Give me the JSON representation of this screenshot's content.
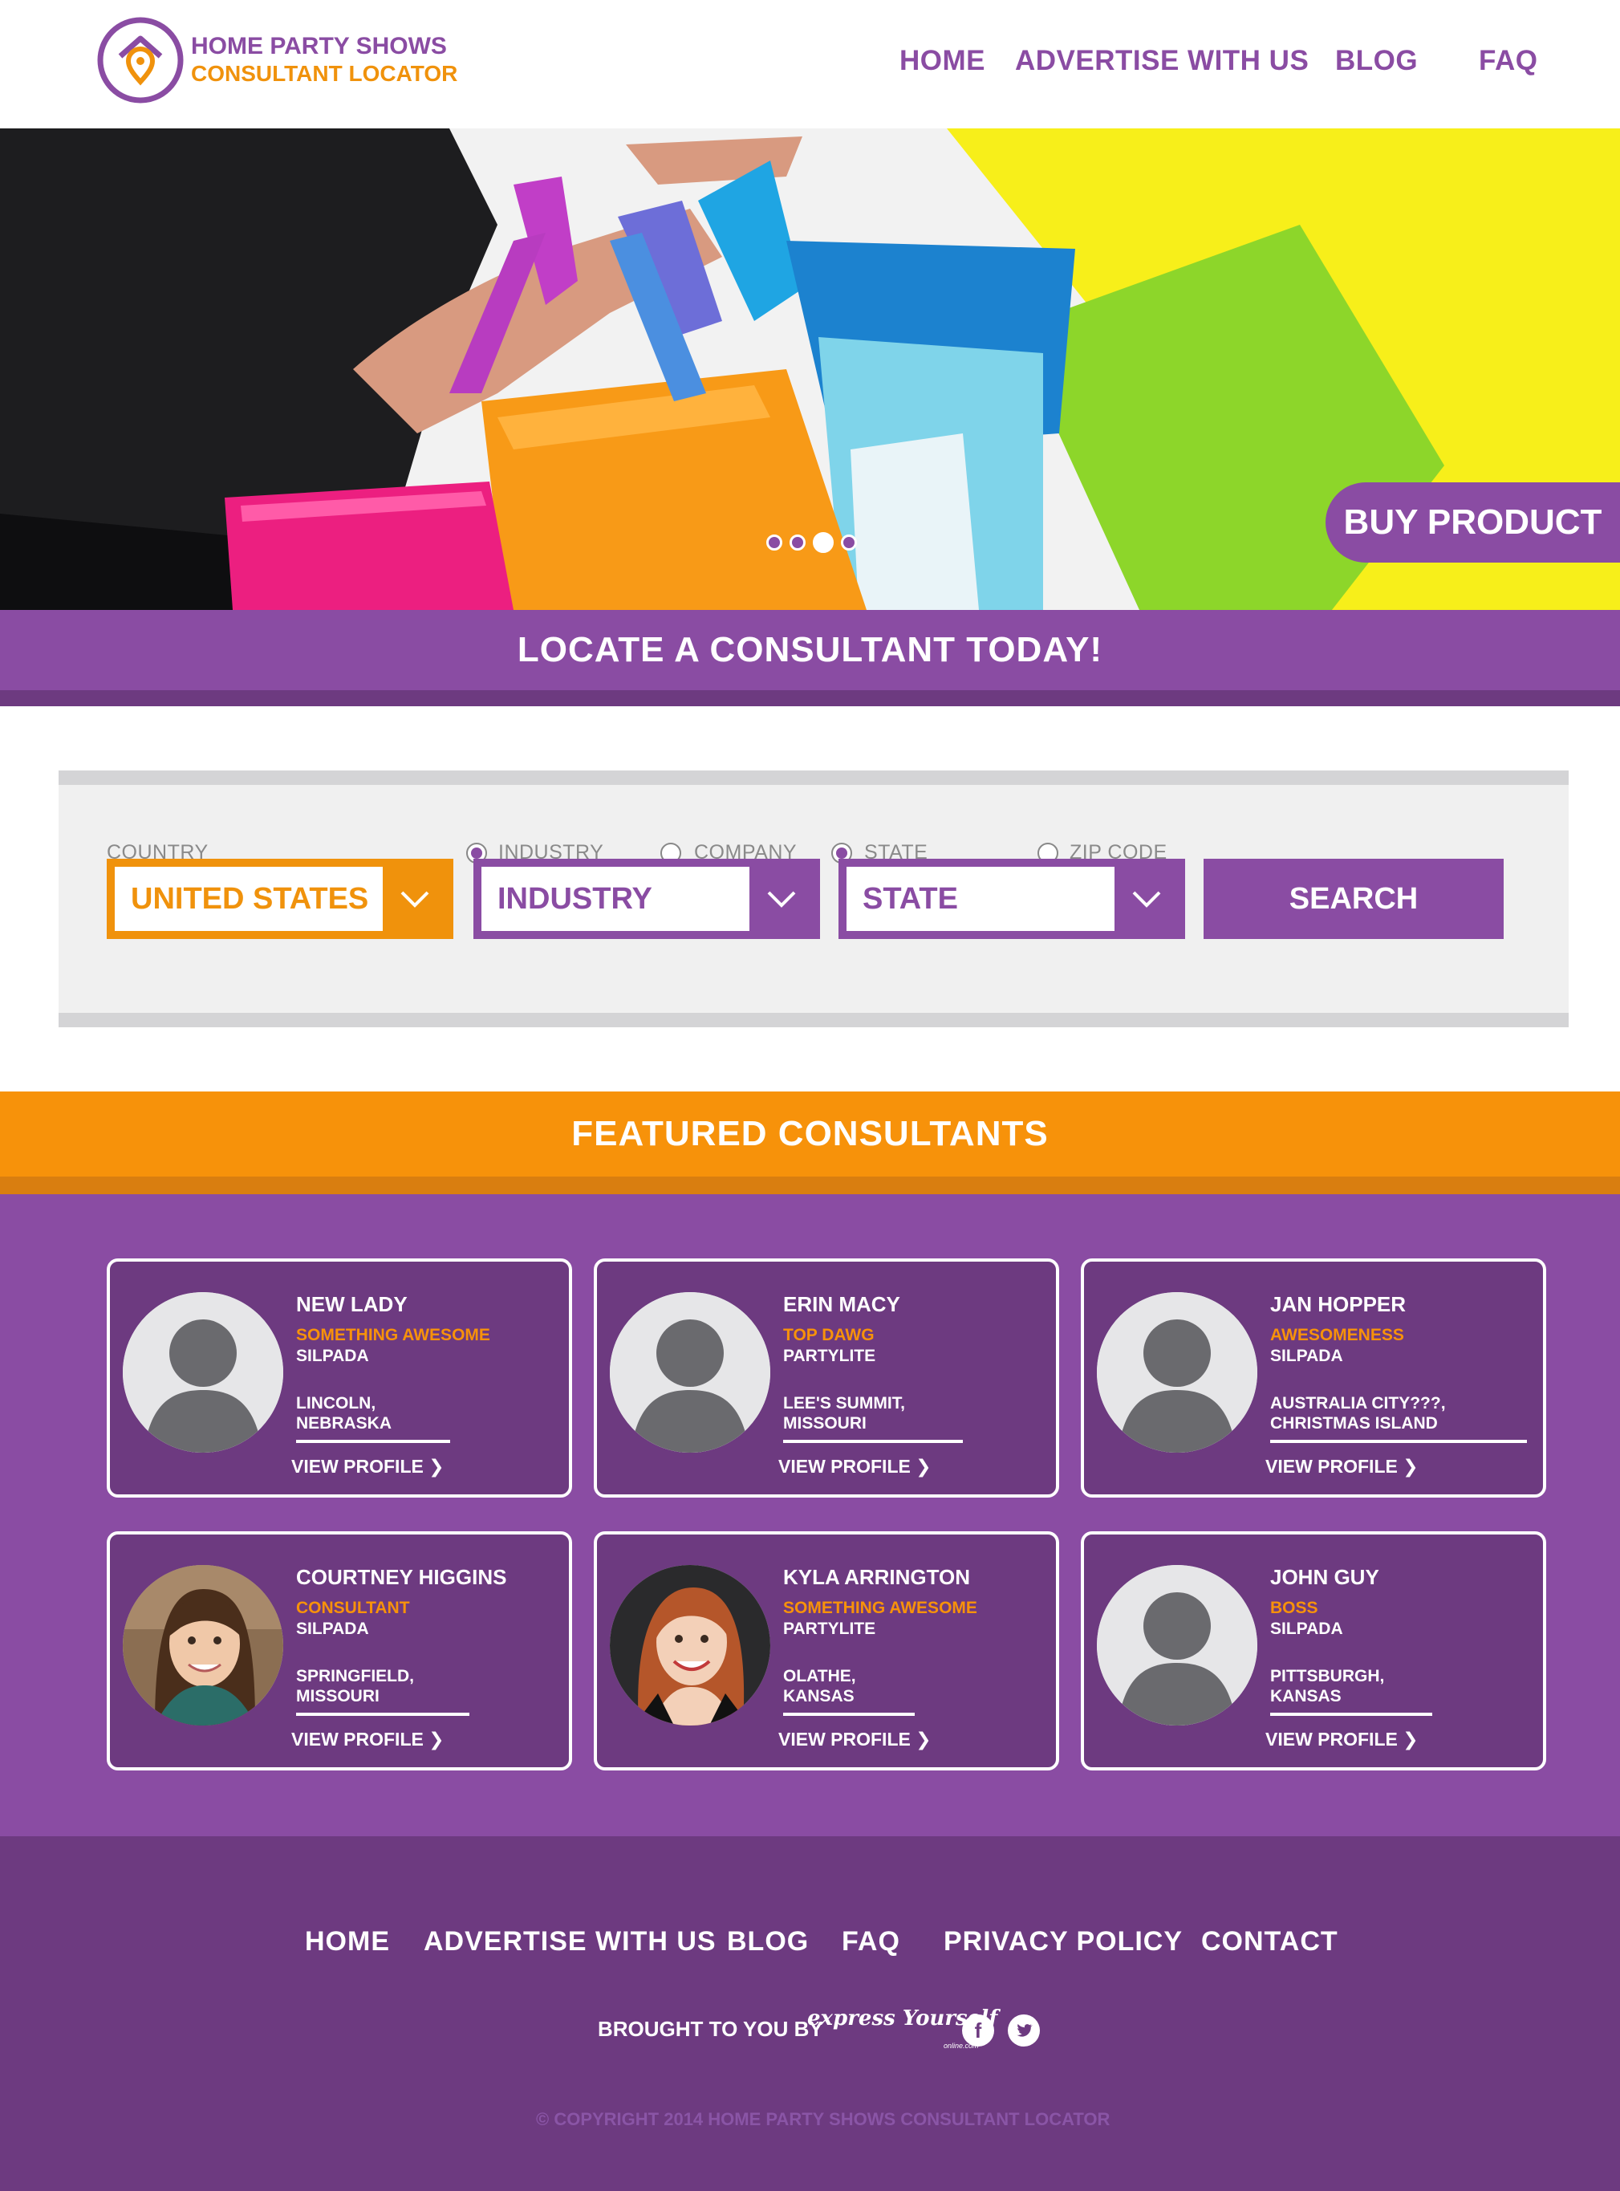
{
  "brand": {
    "line1": "HOME PARTY SHOWS",
    "line2": "CONSULTANT LOCATOR",
    "purple": "#8a4ca3",
    "dark_purple": "#6d3a80",
    "orange": "#f7920a"
  },
  "nav": [
    "HOME",
    "ADVERTISE WITH US",
    "BLOG",
    "FAQ"
  ],
  "hero": {
    "cta": "BUY PRODUCT",
    "slide_count": 4,
    "active_slide": 3
  },
  "locate": {
    "title": "LOCATE A CONSULTANT TODAY!"
  },
  "search": {
    "country_label": "COUNTRY",
    "country_value": "UNITED STATES",
    "radio_industry": "INDUSTRY",
    "radio_company": "COMPANY",
    "radio_state": "STATE",
    "radio_zip": "ZIP CODE",
    "industry_value": "INDUSTRY",
    "state_value": "STATE",
    "button": "SEARCH"
  },
  "featured": {
    "title": "FEATURED CONSULTANTS",
    "view_label": "VIEW PROFILE",
    "consultants": [
      {
        "name": "NEW LADY",
        "title": "SOMETHING AWESOME",
        "company": "SILPADA",
        "location": "LINCOLN, NEBRASKA",
        "photo": "placeholder-silhouette"
      },
      {
        "name": "ERIN MACY",
        "title": "TOP DAWG",
        "company": "PARTYLITE",
        "location": "LEE'S SUMMIT, MISSOURI",
        "photo": "placeholder-silhouette"
      },
      {
        "name": "JAN HOPPER",
        "title": "AWESOMENESS",
        "company": "SILPADA",
        "location": "AUSTRALIA CITY???, CHRISTMAS ISLAND",
        "photo": "placeholder-silhouette"
      },
      {
        "name": "COURTNEY HIGGINS",
        "title": "CONSULTANT",
        "company": "SILPADA",
        "location": "SPRINGFIELD, MISSOURI",
        "photo": "brunette-portrait"
      },
      {
        "name": "KYLA ARRINGTON",
        "title": "SOMETHING AWESOME",
        "company": "PARTYLITE",
        "location": "OLATHE, KANSAS",
        "photo": "redhead-portrait"
      },
      {
        "name": "JOHN GUY",
        "title": "BOSS",
        "company": "SILPADA",
        "location": "PITTSBURGH, KANSAS",
        "photo": "placeholder-silhouette"
      }
    ]
  },
  "footer": {
    "nav": [
      "HOME",
      "ADVERTISE WITH US",
      "BLOG",
      "FAQ",
      "PRIVACY POLICY",
      "CONTACT"
    ],
    "brought_by": "BROUGHT TO YOU BY",
    "sponsor_logo": "express Yourself",
    "sponsor_sub": "online.com",
    "social": [
      "facebook-icon",
      "twitter-icon"
    ],
    "copyright": "© COPYRIGHT 2014 HOME PARTY SHOWS CONSULTANT LOCATOR"
  }
}
